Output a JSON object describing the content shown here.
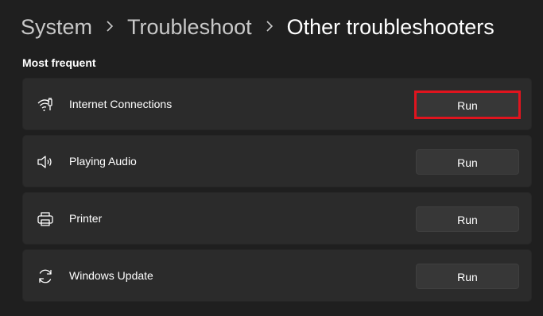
{
  "breadcrumb": {
    "items": [
      "System",
      "Troubleshoot",
      "Other troubleshooters"
    ]
  },
  "section": {
    "title": "Most frequent"
  },
  "troubleshooters": [
    {
      "label": "Internet Connections",
      "icon": "wifi-icon",
      "button": "Run",
      "highlighted": true
    },
    {
      "label": "Playing Audio",
      "icon": "speaker-icon",
      "button": "Run",
      "highlighted": false
    },
    {
      "label": "Printer",
      "icon": "printer-icon",
      "button": "Run",
      "highlighted": false
    },
    {
      "label": "Windows Update",
      "icon": "sync-icon",
      "button": "Run",
      "highlighted": false
    }
  ],
  "colors": {
    "background": "#1f1f1f",
    "card": "#2b2b2b",
    "button": "#373737",
    "highlight": "#e0141e"
  }
}
